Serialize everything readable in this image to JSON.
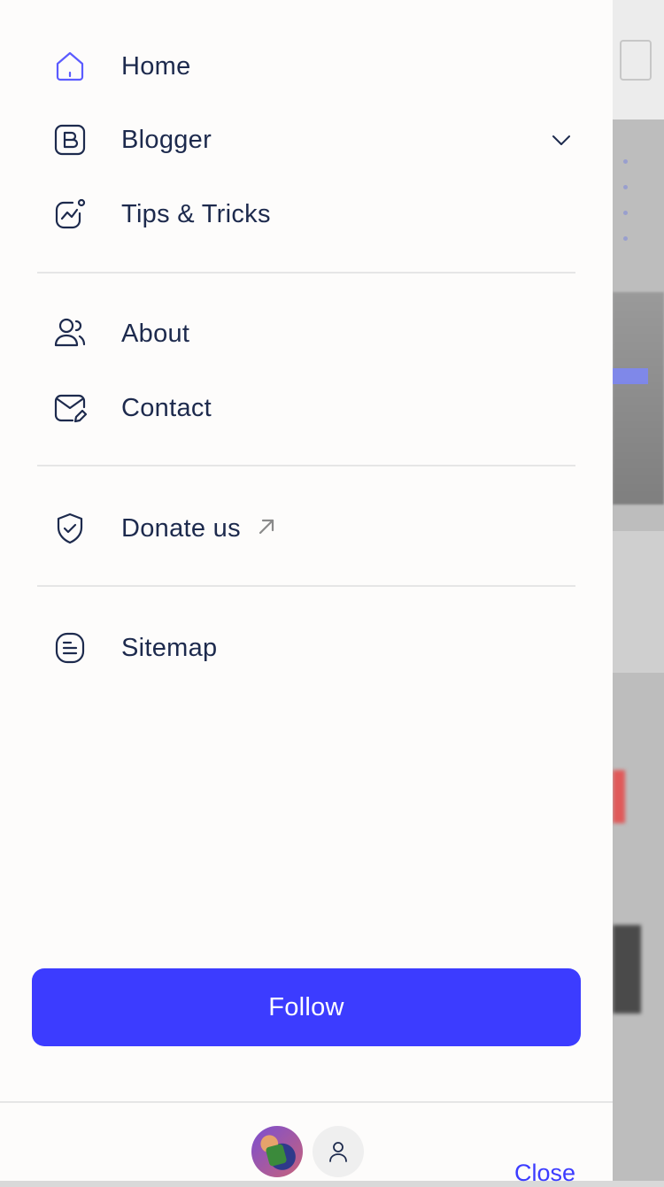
{
  "menu": {
    "group1": [
      {
        "label": "Home",
        "icon": "home-icon"
      },
      {
        "label": "Blogger",
        "icon": "blogger-icon",
        "has_submenu": true
      },
      {
        "label": "Tips & Tricks",
        "icon": "trend-chart-icon"
      }
    ],
    "group2": [
      {
        "label": "About",
        "icon": "users-icon"
      },
      {
        "label": "Contact",
        "icon": "mail-edit-icon"
      }
    ],
    "group3": [
      {
        "label": "Donate us",
        "icon": "shield-check-icon",
        "external": true
      }
    ],
    "group4": [
      {
        "label": "Sitemap",
        "icon": "document-list-icon"
      }
    ]
  },
  "follow_button": {
    "label": "Follow"
  },
  "footer": {
    "close_label": "Close"
  },
  "colors": {
    "accent": "#3c3cff",
    "home_icon": "#5b5bff",
    "text": "#1d2a4d",
    "icon": "#1d2a4d"
  }
}
